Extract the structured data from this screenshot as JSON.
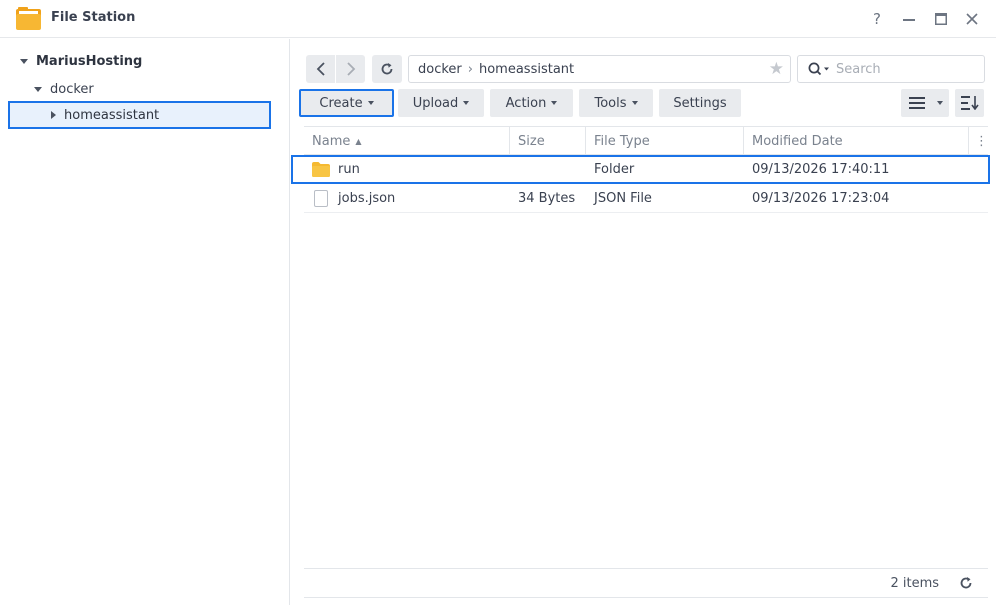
{
  "window": {
    "title": "File Station",
    "controls": {
      "help": "?",
      "minimize": "—",
      "maximize": "▭",
      "close": "✕"
    }
  },
  "sidebar": {
    "root": "MariusHosting",
    "folder": "docker",
    "selected": "homeassistant"
  },
  "path": {
    "segments": [
      "docker",
      "homeassistant"
    ],
    "separator": "›"
  },
  "search": {
    "placeholder": "Search"
  },
  "toolbar": {
    "create": "Create",
    "upload": "Upload",
    "action": "Action",
    "tools": "Tools",
    "settings": "Settings"
  },
  "table": {
    "headers": {
      "name": "Name",
      "size": "Size",
      "type": "File Type",
      "modified": "Modified Date"
    },
    "rows": [
      {
        "name": "run",
        "size": "",
        "type": "Folder",
        "modified": "09/13/2026 17:40:11",
        "icon": "folder-icon"
      },
      {
        "name": "jobs.json",
        "size": "34 Bytes",
        "type": "JSON File",
        "modified": "09/13/2026 17:23:04",
        "icon": "file-icon"
      }
    ]
  },
  "footer": {
    "count": "2 items"
  },
  "colors": {
    "accent": "#1a73e8",
    "folder": "#f5b931",
    "selected_bg": "#e8f1fc"
  }
}
